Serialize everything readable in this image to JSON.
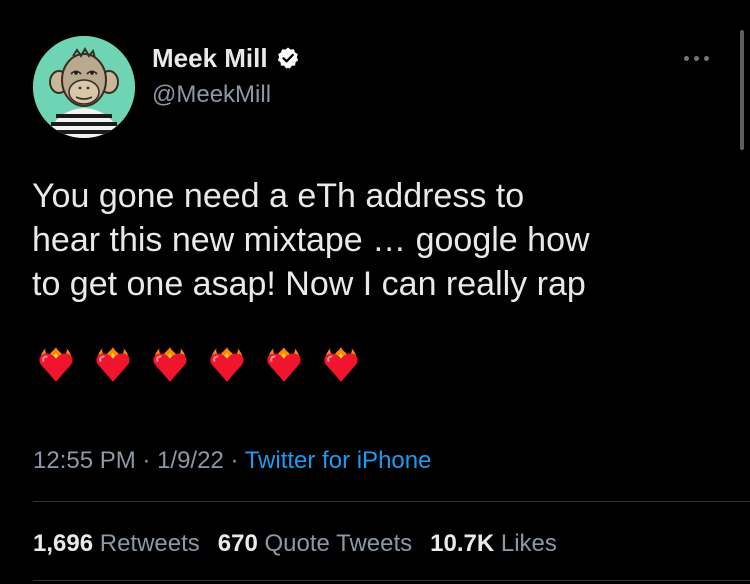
{
  "user": {
    "display_name": "Meek Mill",
    "handle": "@MeekMill",
    "verified": true,
    "avatar_icon": "bored-ape-avatar",
    "avatar_bg": "#6fd4b4"
  },
  "tweet": {
    "text": "You gone need a eTh address to\nhear this new mixtape … google how\nto get one asap! Now I can really rap",
    "emojis": [
      "heart-on-fire",
      "heart-on-fire",
      "heart-on-fire",
      "heart-on-fire",
      "heart-on-fire",
      "heart-on-fire"
    ]
  },
  "meta": {
    "time": "12:55 PM",
    "sep1": " · ",
    "date": "1/9/22",
    "sep2": " · ",
    "source": "Twitter for iPhone"
  },
  "stats": [
    {
      "count": "1,696",
      "label": "Retweets"
    },
    {
      "count": "670",
      "label": "Quote Tweets"
    },
    {
      "count": "10.7K",
      "label": "Likes"
    }
  ],
  "colors": {
    "background": "#000000",
    "text": "#e7e9ea",
    "secondary": "#8b98a5",
    "link": "#1d9bf0",
    "verified": "#ffffff"
  }
}
